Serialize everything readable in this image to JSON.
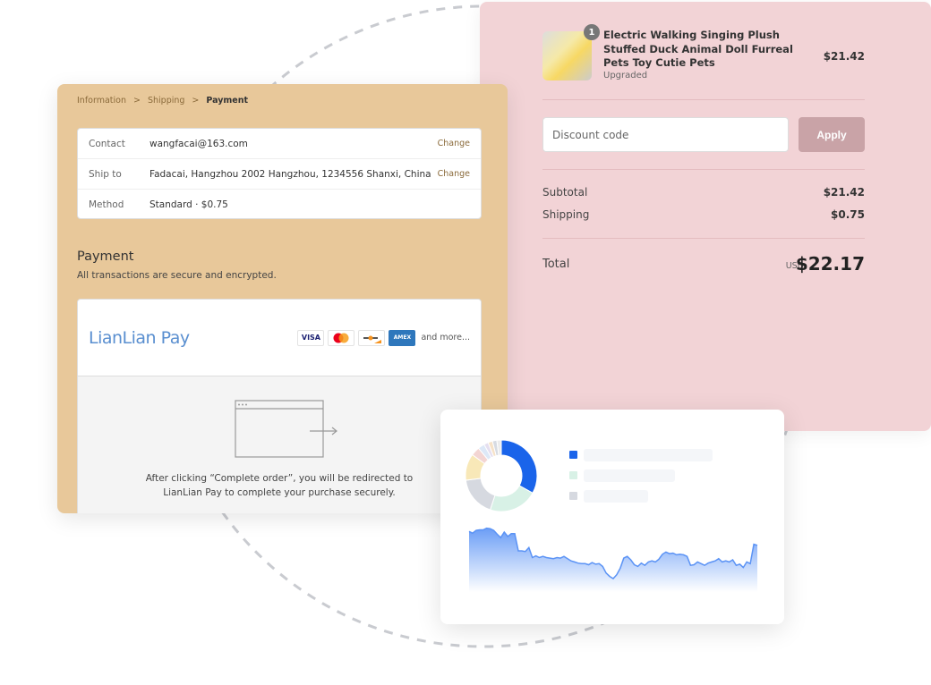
{
  "checkout": {
    "breadcrumb": [
      "Information",
      "Shipping",
      "Payment"
    ],
    "contact": {
      "label": "Contact",
      "value": "wangfacai@163.com",
      "action": "Change"
    },
    "ship_to": {
      "label": "Ship to",
      "value": "Fadacai, Hangzhou 2002 Hangzhou, 1234556 Shanxi, China",
      "action": "Change"
    },
    "method": {
      "label": "Method",
      "value": "Standard · $0.75"
    },
    "payment": {
      "title": "Payment",
      "subtitle": "All transactions are secure and encrypted.",
      "provider": "LianLian Pay",
      "cards": [
        "VISA",
        "mastercard",
        "discover",
        "AMEX"
      ],
      "and_more": "and more...",
      "redirect_text": "After clicking “Complete order”, you will be redirected to LianLian Pay to complete your purchase securely."
    }
  },
  "summary": {
    "product": {
      "quantity": "1",
      "title": "Electric Walking Singing Plush Stuffed Duck Animal Doll Furreal Pets Toy Cutie Pets",
      "variant": "Upgraded",
      "price": "$21.42"
    },
    "discount_placeholder": "Discount code",
    "apply_label": "Apply",
    "subtotal_label": "Subtotal",
    "subtotal": "$21.42",
    "shipping_label": "Shipping",
    "shipping": "$0.75",
    "total_label": "Total",
    "currency": "USD",
    "total": "$22.17"
  },
  "chart_data": [
    {
      "type": "pie",
      "donut": true,
      "values": [
        33,
        22,
        18,
        12,
        4,
        3,
        2,
        2,
        2,
        2
      ],
      "colors": [
        "#1a64ea",
        "#d8f1e6",
        "#d6d9e0",
        "#f8e8b8",
        "#f3d5d3",
        "#dde8f7",
        "#e5dff0",
        "#f6e2c8",
        "#d7dbe2",
        "#ececec"
      ],
      "legend_colors": [
        "#1a64ea",
        "#d8f1e6",
        "#d6d9e0"
      ]
    },
    {
      "type": "area",
      "color": "#5b93f5",
      "values": [
        93,
        90,
        95,
        96,
        96,
        99,
        98,
        95,
        88,
        82,
        92,
        84,
        89,
        89,
        58,
        58,
        57,
        64,
        46,
        49,
        46,
        48,
        46,
        45,
        44,
        46,
        45,
        48,
        44,
        40,
        38,
        36,
        35,
        35,
        33,
        37,
        34,
        35,
        30,
        18,
        12,
        8,
        15,
        27,
        45,
        48,
        42,
        33,
        30,
        36,
        32,
        38,
        40,
        38,
        43,
        52,
        56,
        53,
        54,
        51,
        52,
        51,
        48,
        32,
        33,
        38,
        35,
        32,
        36,
        38,
        40,
        44,
        38,
        40,
        38,
        42,
        32,
        34,
        28,
        38,
        35,
        70,
        68
      ]
    }
  ]
}
